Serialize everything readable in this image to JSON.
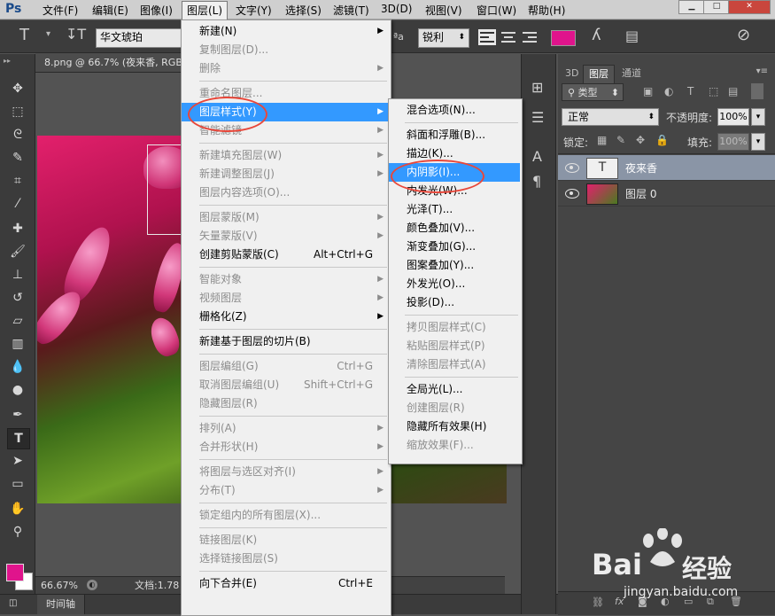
{
  "menubar": {
    "logo": "Ps",
    "items": [
      "文件(F)",
      "编辑(E)",
      "图像(I)",
      "图层(L)",
      "文字(Y)",
      "选择(S)",
      "滤镜(T)",
      "3D(D)",
      "视图(V)",
      "窗口(W)",
      "帮助(H)"
    ],
    "active_index": 3
  },
  "options": {
    "tool_glyph": "T",
    "font_family": "华文琥珀",
    "antialias": "锐利",
    "text_color": "#e0148c"
  },
  "document": {
    "tab_title": "8.png @ 66.7% (夜来香, RGB",
    "zoom": "66.67%",
    "doc_info": "文档:1.78"
  },
  "timeline_label": "时间轴",
  "layers_panel": {
    "tabs": [
      "3D",
      "图层",
      "通道"
    ],
    "filter_label": "类型",
    "blend_mode": "正常",
    "opacity_label": "不透明度:",
    "opacity_value": "100%",
    "lock_label": "锁定:",
    "fill_label": "填充:",
    "fill_value": "100%",
    "layers": [
      {
        "name": "夜来香",
        "kind": "text",
        "thumb": "T",
        "selected": true
      },
      {
        "name": "图层 0",
        "kind": "image",
        "selected": false
      }
    ]
  },
  "layer_menu": {
    "items": [
      {
        "label": "新建(N)",
        "sub": true,
        "disabled": false
      },
      {
        "label": "复制图层(D)...",
        "disabled": true
      },
      {
        "label": "删除",
        "sub": true,
        "disabled": true
      },
      {
        "sep": true
      },
      {
        "label": "重命名图层...",
        "disabled": true
      },
      {
        "label": "图层样式(Y)",
        "sub": true,
        "highlight": true
      },
      {
        "label": "智能滤镜",
        "sub": true,
        "disabled": true
      },
      {
        "sep": true
      },
      {
        "label": "新建填充图层(W)",
        "sub": true,
        "disabled": true
      },
      {
        "label": "新建调整图层(J)",
        "sub": true,
        "disabled": true
      },
      {
        "label": "图层内容选项(O)...",
        "disabled": true
      },
      {
        "sep": true
      },
      {
        "label": "图层蒙版(M)",
        "sub": true,
        "disabled": true
      },
      {
        "label": "矢量蒙版(V)",
        "sub": true,
        "disabled": true
      },
      {
        "label": "创建剪贴蒙版(C)",
        "shortcut": "Alt+Ctrl+G"
      },
      {
        "sep": true
      },
      {
        "label": "智能对象",
        "sub": true,
        "disabled": true
      },
      {
        "label": "视频图层",
        "sub": true,
        "disabled": true
      },
      {
        "label": "栅格化(Z)",
        "sub": true
      },
      {
        "sep": true
      },
      {
        "label": "新建基于图层的切片(B)"
      },
      {
        "sep": true
      },
      {
        "label": "图层编组(G)",
        "shortcut": "Ctrl+G",
        "disabled": true
      },
      {
        "label": "取消图层编组(U)",
        "shortcut": "Shift+Ctrl+G",
        "disabled": true
      },
      {
        "label": "隐藏图层(R)",
        "disabled": true
      },
      {
        "sep": true
      },
      {
        "label": "排列(A)",
        "sub": true,
        "disabled": true
      },
      {
        "label": "合并形状(H)",
        "sub": true,
        "disabled": true
      },
      {
        "sep": true
      },
      {
        "label": "将图层与选区对齐(I)",
        "sub": true,
        "disabled": true
      },
      {
        "label": "分布(T)",
        "sub": true,
        "disabled": true
      },
      {
        "sep": true
      },
      {
        "label": "锁定组内的所有图层(X)...",
        "disabled": true
      },
      {
        "sep": true
      },
      {
        "label": "链接图层(K)",
        "disabled": true
      },
      {
        "label": "选择链接图层(S)",
        "disabled": true
      },
      {
        "sep": true
      },
      {
        "label": "向下合并(E)",
        "shortcut": "Ctrl+E"
      }
    ]
  },
  "style_submenu": {
    "items": [
      {
        "label": "混合选项(N)..."
      },
      {
        "sep": true
      },
      {
        "label": "斜面和浮雕(B)..."
      },
      {
        "label": "描边(K)..."
      },
      {
        "label": "内阴影(I)...",
        "highlight": true
      },
      {
        "label": "内发光(W)..."
      },
      {
        "label": "光泽(T)..."
      },
      {
        "label": "颜色叠加(V)..."
      },
      {
        "label": "渐变叠加(G)..."
      },
      {
        "label": "图案叠加(Y)..."
      },
      {
        "label": "外发光(O)..."
      },
      {
        "label": "投影(D)..."
      },
      {
        "sep": true
      },
      {
        "label": "拷贝图层样式(C)",
        "disabled": true
      },
      {
        "label": "粘贴图层样式(P)",
        "disabled": true
      },
      {
        "label": "清除图层样式(A)",
        "disabled": true
      },
      {
        "sep": true
      },
      {
        "label": "全局光(L)..."
      },
      {
        "label": "创建图层(R)",
        "disabled": true
      },
      {
        "label": "隐藏所有效果(H)"
      },
      {
        "label": "缩放效果(F)...",
        "disabled": true
      }
    ]
  },
  "watermark": {
    "brand_left": "Bai",
    "brand_right": "经验",
    "url": "jingyan.baidu.com"
  }
}
